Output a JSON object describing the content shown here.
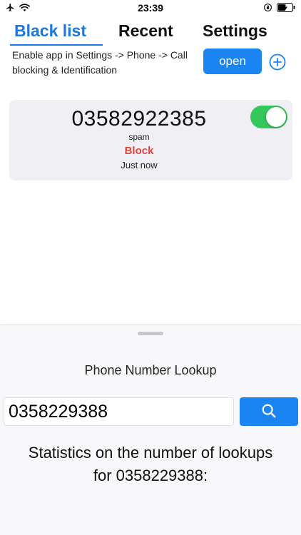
{
  "status_bar": {
    "time": "23:39",
    "icons": [
      "airplane-icon",
      "wifi-icon",
      "orientation-lock-icon",
      "battery-charging-icon"
    ]
  },
  "tabs": [
    {
      "label": "Black list",
      "active": true
    },
    {
      "label": "Recent",
      "active": false
    },
    {
      "label": "Settings",
      "active": false
    }
  ],
  "notice": {
    "text": "Enable app in Settings -> Phone -> Call blocking & Identification",
    "open_label": "open"
  },
  "entry": {
    "number": "03582922385",
    "tag": "spam",
    "action": "Block",
    "time": "Just now",
    "enabled": true
  },
  "lookup": {
    "title": "Phone Number Lookup",
    "value": "0358229388",
    "stats": "Statistics on the number of lookups for 0358229388:"
  },
  "colors": {
    "accent": "#1a84f2",
    "block": "#e0443a",
    "toggle_on": "#34c759"
  }
}
